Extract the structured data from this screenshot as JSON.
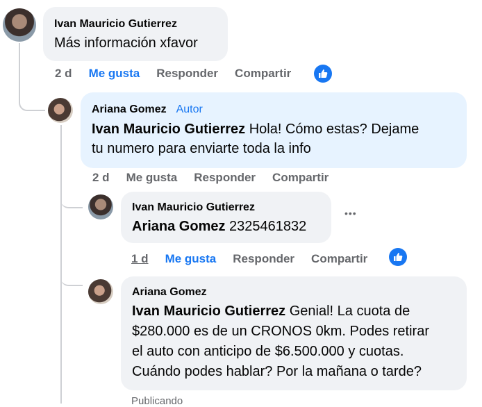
{
  "comments": [
    {
      "author": "Ivan Mauricio Gutierrez",
      "text": "Más información xfavor",
      "actions": {
        "time": "2 d",
        "like": "Me gusta",
        "reply": "Responder",
        "share": "Compartir"
      }
    },
    {
      "author": "Ariana Gomez",
      "author_badge": "Autor",
      "mention": "Ivan Mauricio Gutierrez",
      "text_line1": " Hola! Cómo estas? Dejame",
      "text_line2": "tu numero para enviarte toda la info",
      "actions": {
        "time": "2 d",
        "like": "Me gusta",
        "reply": "Responder",
        "share": "Compartir"
      }
    },
    {
      "author": "Ivan Mauricio Gutierrez",
      "mention": "Ariana Gomez",
      "text": " 2325461832",
      "more": "•••",
      "actions": {
        "time": "1 d",
        "like": "Me gusta",
        "reply": "Responder",
        "share": "Compartir"
      }
    },
    {
      "author": "Ariana Gomez",
      "mention": "Ivan Mauricio Gutierrez",
      "text_line1": " Genial! La cuota de",
      "text_line2": "$280.000 es de un CRONOS 0km. Podes retirar",
      "text_line3": "el auto con anticipo de $6.500.000 y cuotas.",
      "text_line4": "Cuándo podes hablar? Por la mañana o tarde?",
      "status": "Publicando"
    }
  ],
  "icons": {
    "like_badge": "thumbs-up-icon",
    "more": "more-options-icon"
  },
  "colors": {
    "accent": "#1877f2",
    "bubble": "#f0f2f5",
    "author_bubble": "#e7f3ff",
    "muted": "#65676b"
  }
}
